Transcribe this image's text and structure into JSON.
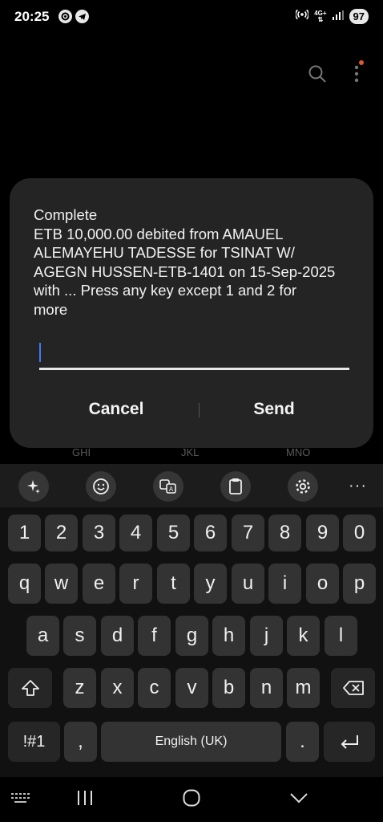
{
  "status_bar": {
    "time": "20:25",
    "battery": "97",
    "network": "4G+",
    "icons": [
      "app-notification-icon",
      "telegram-icon",
      "hotspot-icon",
      "network-icon",
      "signal-icon",
      "battery-icon"
    ]
  },
  "top_bar": {
    "icons": [
      "search-icon",
      "more-vert-icon"
    ]
  },
  "dialog": {
    "message_lines": [
      "Complete",
      "ETB 10,000.00 debited from AMAUEL",
      "ALEMAYEHU TADESSE for TSINAT W/",
      "AGEGN HUSSEN-ETB-1401 on 15-Sep-2025",
      "with ... Press any key except 1 and 2 for",
      "more"
    ],
    "input_value": "",
    "cancel_label": "Cancel",
    "send_label": "Send"
  },
  "dialpad_hints": [
    "GHI",
    "JKL",
    "MNO"
  ],
  "keyboard": {
    "toolbar_icons": [
      "ai-sparkle-icon",
      "emoji-icon",
      "translate-icon",
      "clipboard-icon",
      "settings-icon",
      "more-horiz-icon"
    ],
    "toolbar_more": "···",
    "number_row": [
      "1",
      "2",
      "3",
      "4",
      "5",
      "6",
      "7",
      "8",
      "9",
      "0"
    ],
    "row1": [
      "q",
      "w",
      "e",
      "r",
      "t",
      "y",
      "u",
      "i",
      "o",
      "p"
    ],
    "row2": [
      "a",
      "s",
      "d",
      "f",
      "g",
      "h",
      "j",
      "k",
      "l"
    ],
    "row3": [
      "z",
      "x",
      "c",
      "v",
      "b",
      "n",
      "m"
    ],
    "symbols_label": "!#1",
    "comma_label": ",",
    "space_label": "English (UK)",
    "period_label": ".",
    "icons": [
      "shift-icon",
      "backspace-icon",
      "enter-icon"
    ]
  },
  "nav_bar": {
    "icons": [
      "keyboard-switch-icon",
      "recents-icon",
      "home-icon",
      "back-icon"
    ]
  }
}
